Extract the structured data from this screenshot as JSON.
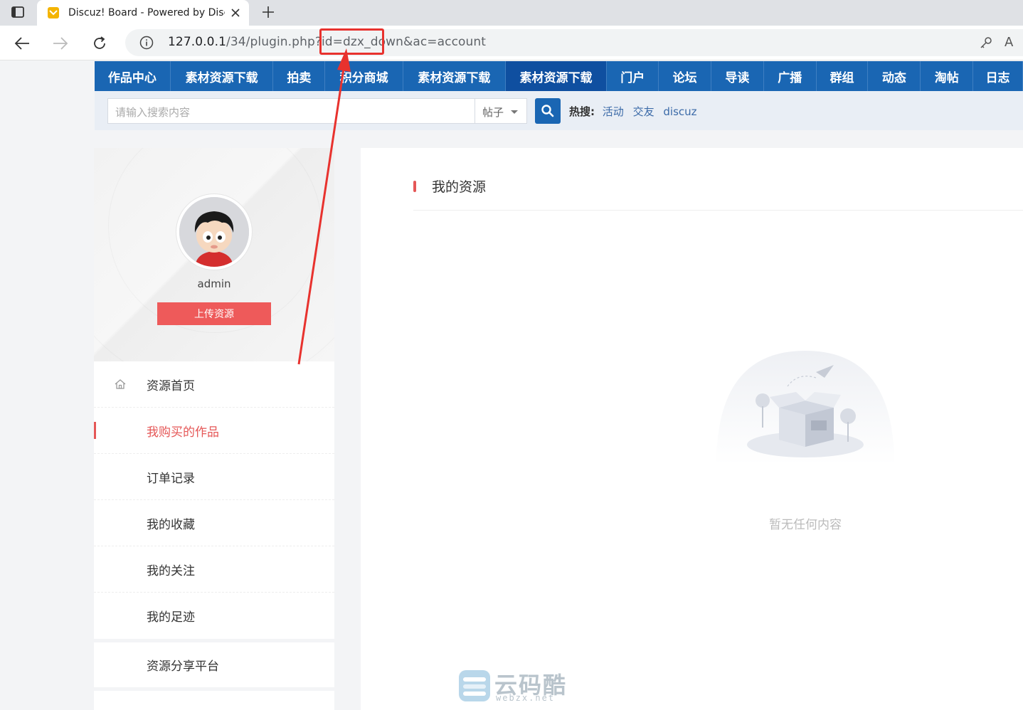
{
  "browser": {
    "tab_title": "Discuz! Board - Powered by Discuz!",
    "url_main": "127.0.0.1",
    "url_rest": "/34/plugin.php?id=dzx_down&ac=account"
  },
  "site_nav": [
    {
      "label": "作品中心",
      "w": 107
    },
    {
      "label": "素材资源下载",
      "w": 145
    },
    {
      "label": "拍卖",
      "w": 73
    },
    {
      "label": "积分商城",
      "w": 110
    },
    {
      "label": "素材资源下载",
      "w": 144
    },
    {
      "label": "素材资源下载",
      "w": 143,
      "active": true
    },
    {
      "label": "门户",
      "w": 73
    },
    {
      "label": "论坛",
      "w": 74
    },
    {
      "label": "导读",
      "w": 74
    },
    {
      "label": "广播",
      "w": 74
    },
    {
      "label": "群组",
      "w": 73
    },
    {
      "label": "动态",
      "w": 74
    },
    {
      "label": "淘帖",
      "w": 74
    },
    {
      "label": "日志",
      "w": 70
    }
  ],
  "search": {
    "placeholder": "请输入搜索内容",
    "type": "帖子",
    "hot_label": "热搜:",
    "hot_links": [
      "活动",
      "交友",
      "discuz"
    ]
  },
  "profile": {
    "username": "admin",
    "upload_label": "上传资源"
  },
  "menu": {
    "items": [
      "资源首页",
      "我购买的作品",
      "订单记录",
      "我的收藏",
      "我的关注",
      "我的足迹"
    ],
    "share": "资源分享平台"
  },
  "main": {
    "title": "我的资源",
    "empty": "暂无任何内容"
  },
  "watermark": {
    "name": "云码酷",
    "domain": "webzx.net"
  },
  "colors": {
    "nav_blue": "#1a66b3",
    "accent_red": "#e55757",
    "annotation_red": "#e8322e"
  }
}
